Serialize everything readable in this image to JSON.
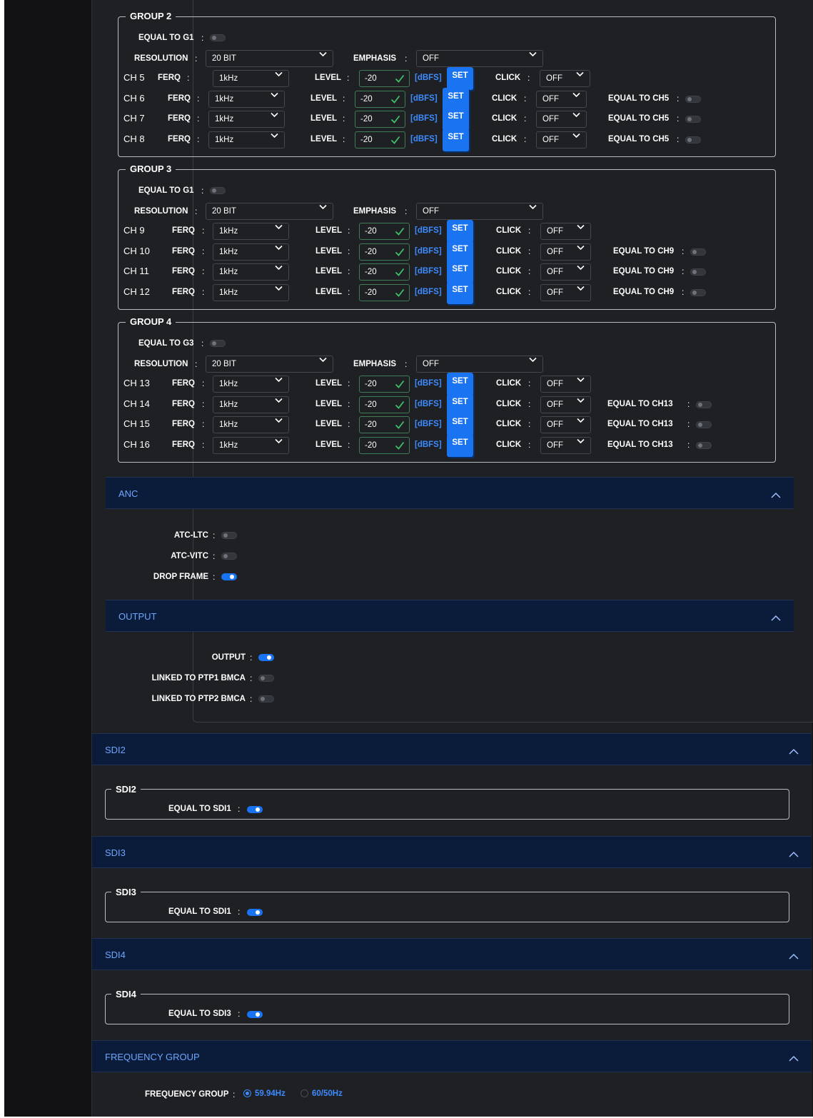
{
  "common": {
    "equal_to_g1": "EQUAL TO G1",
    "equal_to_g3": "EQUAL TO G3",
    "colon": ":",
    "resolution_label": "RESOLUTION",
    "emphasis_label": "EMPHASIS",
    "ferq_label": "FERQ",
    "level_label": "LEVEL",
    "dbfs": "[dBFS]",
    "set_label": "SET",
    "click_label": "CLICK"
  },
  "groups": [
    {
      "title": "GROUP 2",
      "equal_label": "EQUAL TO G1",
      "resolution": "20 BIT",
      "emphasis": "OFF",
      "channels": [
        {
          "name": "CH 5",
          "ferq": "1kHz",
          "level": "-20",
          "click": "OFF",
          "equal": ""
        },
        {
          "name": "CH 6",
          "ferq": "1kHz",
          "level": "-20",
          "click": "OFF",
          "equal": "EQUAL TO CH5"
        },
        {
          "name": "CH 7",
          "ferq": "1kHz",
          "level": "-20",
          "click": "OFF",
          "equal": "EQUAL TO CH5"
        },
        {
          "name": "CH 8",
          "ferq": "1kHz",
          "level": "-20",
          "click": "OFF",
          "equal": "EQUAL TO CH5"
        }
      ]
    },
    {
      "title": "GROUP 3",
      "equal_label": "EQUAL TO G1",
      "resolution": "20 BIT",
      "emphasis": "OFF",
      "channels": [
        {
          "name": "CH 9",
          "ferq": "1kHz",
          "level": "-20",
          "click": "OFF",
          "equal": ""
        },
        {
          "name": "CH 10",
          "ferq": "1kHz",
          "level": "-20",
          "click": "OFF",
          "equal": "EQUAL TO CH9"
        },
        {
          "name": "CH 11",
          "ferq": "1kHz",
          "level": "-20",
          "click": "OFF",
          "equal": "EQUAL TO CH9"
        },
        {
          "name": "CH 12",
          "ferq": "1kHz",
          "level": "-20",
          "click": "OFF",
          "equal": "EQUAL TO CH9"
        }
      ]
    },
    {
      "title": "GROUP 4",
      "equal_label": "EQUAL TO G3",
      "resolution": "20 BIT",
      "emphasis": "OFF",
      "channels": [
        {
          "name": "CH 13",
          "ferq": "1kHz",
          "level": "-20",
          "click": "OFF",
          "equal": ""
        },
        {
          "name": "CH 14",
          "ferq": "1kHz",
          "level": "-20",
          "click": "OFF",
          "equal": "EQUAL TO CH13"
        },
        {
          "name": "CH 15",
          "ferq": "1kHz",
          "level": "-20",
          "click": "OFF",
          "equal": "EQUAL TO CH13"
        },
        {
          "name": "CH 16",
          "ferq": "1kHz",
          "level": "-20",
          "click": "OFF",
          "equal": "EQUAL TO CH13"
        }
      ]
    }
  ],
  "anc": {
    "title": "ANC",
    "items": [
      {
        "label": "ATC-LTC",
        "on": false
      },
      {
        "label": "ATC-VITC",
        "on": false
      },
      {
        "label": "DROP FRAME",
        "on": true
      }
    ]
  },
  "output": {
    "title": "OUTPUT",
    "items": [
      {
        "label": "OUTPUT",
        "on": true
      },
      {
        "label": "LINKED TO PTP1 BMCA",
        "on": false
      },
      {
        "label": "LINKED TO PTP2 BMCA",
        "on": false
      }
    ]
  },
  "sdi": [
    {
      "title": "SDI2",
      "box_title": "SDI2",
      "equal_label": "EQUAL TO SDI1",
      "on": true
    },
    {
      "title": "SDI3",
      "box_title": "SDI3",
      "equal_label": "EQUAL TO SDI1",
      "on": true
    },
    {
      "title": "SDI4",
      "box_title": "SDI4",
      "equal_label": "EQUAL TO SDI3",
      "on": true
    }
  ],
  "frequency_group": {
    "title": "FREQUENCY GROUP",
    "label": "FREQUENCY GROUP",
    "options": [
      "59.94Hz",
      "60/50Hz"
    ],
    "selected": "59.94Hz"
  },
  "colors": {
    "accent": "#1a73f0",
    "header_bg": "#0b1b3a",
    "header_text": "#6da7ff",
    "panel_bg": "#1e2023",
    "valid_green": "#3fbf6a"
  }
}
